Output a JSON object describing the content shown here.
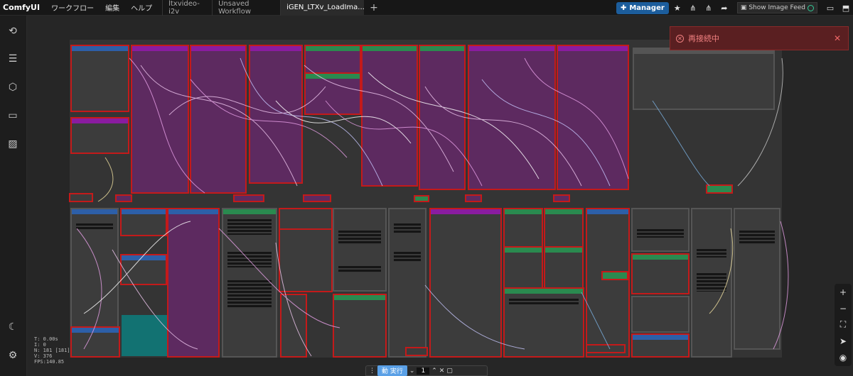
{
  "app": {
    "brand": "ComfyUI"
  },
  "menu": [
    "ワークフロー",
    "編集",
    "ヘルプ"
  ],
  "tabs": [
    "ltxvideo-i2v",
    "Unsaved Workflow",
    "iGEN_LTXv_LoadIma..."
  ],
  "toolbar": {
    "manager_label": "Manager",
    "show_feed_label": "Show Image Feed"
  },
  "stats": {
    "t": "T: 0.00s",
    "i": "I: 0",
    "n": "N: 181 [181]",
    "v": "V: 376",
    "fps": "FPS:140.85"
  },
  "toast": {
    "message": "再接続中"
  },
  "runbar": {
    "mode_label": "動",
    "run_label": "実行",
    "count": "1"
  },
  "colors": {
    "node_border": "#c41a1a",
    "purple_node": "#5d2a60",
    "purple_header": "#8a1ca0",
    "green_header": "#2a8a4f",
    "blue_header": "#2d5fa8",
    "teal_fill": "#127272",
    "toast_bg": "#5a1f21",
    "manager_bg": "#1c5d9c"
  }
}
